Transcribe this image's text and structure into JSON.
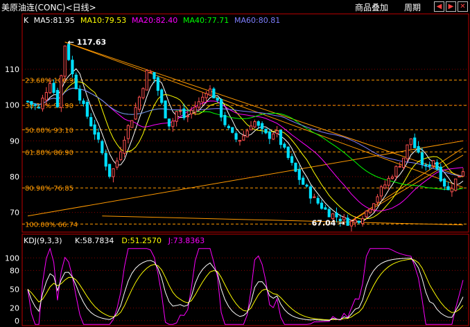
{
  "window": {
    "title": "美原油连(CONC)<日线>",
    "buttons": [
      "商品叠加",
      "周期"
    ],
    "nav_icons": [
      "scroll-left-icon",
      "scroll-right-icon",
      "exit-icon"
    ]
  },
  "main_panel": {
    "legend": [
      {
        "label": "K",
        "color": "#ffffff"
      },
      {
        "label": "MA5:81.95",
        "color": "#ffffff"
      },
      {
        "label": "MA10:79.53",
        "color": "#ffff00"
      },
      {
        "label": "MA20:82.40",
        "color": "#ff00ff"
      },
      {
        "label": "MA40:77.71",
        "color": "#00ff00"
      },
      {
        "label": "MA60:80.81",
        "color": "#7f7fff"
      }
    ],
    "annotations": {
      "high": "117.63",
      "low": "67.04"
    },
    "fib_levels": [
      {
        "label": "23.60% 106.98",
        "value": 106.98
      },
      {
        "label": "38.20% 99.90",
        "value": 99.9
      },
      {
        "label": "50.00% 93.10",
        "value": 93.1
      },
      {
        "label": "61.80% 86.90",
        "value": 86.9
      },
      {
        "label": "80.90% 76.85",
        "value": 76.85
      },
      {
        "label": "100.00% 66.74",
        "value": 66.74
      }
    ]
  },
  "kdj_panel": {
    "legend": [
      {
        "label": "KDJ(9,3,3)",
        "color": "#ffffff"
      },
      {
        "label": "K:58.7834",
        "color": "#ffffff"
      },
      {
        "label": "D:51.2570",
        "color": "#ffff00"
      },
      {
        "label": "J:73.8363",
        "color": "#ff00ff"
      }
    ]
  },
  "chart_data": [
    {
      "type": "candlestick",
      "y_ticks": [
        70,
        80,
        90,
        100,
        110
      ],
      "ylim": [
        64.5,
        122
      ],
      "num_bars": 118,
      "colors": {
        "up": "#ff5050",
        "down": "#00e0ff",
        "fib": "#ff9900"
      },
      "price_path": [
        [
          0,
          101
        ],
        [
          3,
          99
        ],
        [
          6,
          107
        ],
        [
          8,
          100
        ],
        [
          10,
          117.6
        ],
        [
          12,
          108
        ],
        [
          15,
          99
        ],
        [
          18,
          92
        ],
        [
          20,
          86
        ],
        [
          22,
          80
        ],
        [
          24,
          85
        ],
        [
          26,
          92
        ],
        [
          28,
          97
        ],
        [
          30,
          103
        ],
        [
          32,
          110
        ],
        [
          34,
          107
        ],
        [
          36,
          99
        ],
        [
          38,
          94
        ],
        [
          40,
          99
        ],
        [
          42,
          96
        ],
        [
          44,
          99
        ],
        [
          46,
          101
        ],
        [
          48,
          105
        ],
        [
          50,
          102
        ],
        [
          52,
          96
        ],
        [
          54,
          92
        ],
        [
          56,
          90
        ],
        [
          58,
          92
        ],
        [
          60,
          96
        ],
        [
          62,
          93
        ],
        [
          64,
          91
        ],
        [
          66,
          93
        ],
        [
          68,
          88
        ],
        [
          70,
          84
        ],
        [
          72,
          80
        ],
        [
          74,
          77
        ],
        [
          76,
          74
        ],
        [
          78,
          72
        ],
        [
          80,
          70
        ],
        [
          82,
          69
        ],
        [
          84,
          68
        ],
        [
          86,
          67.1
        ],
        [
          88,
          68
        ],
        [
          90,
          70
        ],
        [
          92,
          73
        ],
        [
          94,
          76
        ],
        [
          96,
          79
        ],
        [
          98,
          82
        ],
        [
          100,
          85
        ],
        [
          102,
          91
        ],
        [
          104,
          86
        ],
        [
          106,
          82
        ],
        [
          108,
          85
        ],
        [
          110,
          80
        ],
        [
          112,
          76
        ],
        [
          114,
          79
        ],
        [
          116,
          82
        ]
      ]
    },
    {
      "type": "line",
      "y_ticks": [
        0,
        20,
        50,
        80,
        100
      ],
      "ylim": [
        -8,
        118
      ],
      "series": [
        {
          "name": "K",
          "color": "#ffffff"
        },
        {
          "name": "D",
          "color": "#ffff00"
        },
        {
          "name": "J",
          "color": "#ff00ff"
        }
      ]
    }
  ]
}
